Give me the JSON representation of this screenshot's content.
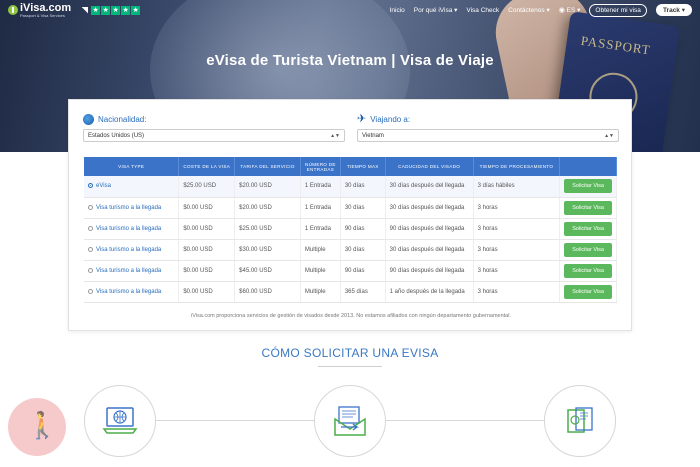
{
  "header": {
    "logo_name": "iVisa.com",
    "logo_sub": "Passport & Visa Services",
    "nav": [
      {
        "label": "Inicio"
      },
      {
        "label": "Por qué iVisa ▾"
      },
      {
        "label": "Visa Check"
      },
      {
        "label": "Contáctenos ▾"
      },
      {
        "label": "ES ▾"
      }
    ],
    "cta_outline": "Obtener mi visa",
    "cta_track": "Track ▾"
  },
  "hero": {
    "title": "eVisa de Turista Vietnam | Visa de Viaje",
    "passport_text": "PASSPORT"
  },
  "form": {
    "nationality_label": "Nacionalidad:",
    "nationality_value": "Estados Unidos (US)",
    "destination_label": "Viajando a:",
    "destination_value": "Vietnam"
  },
  "table": {
    "headers": [
      "Visa type",
      "Coste de la visa",
      "Tarifa del servicio",
      "Número de entradas",
      "Tiempo max",
      "Caducidad del visado",
      "Tiempo de procesamiento",
      ""
    ],
    "rows": [
      {
        "name": "eVisa",
        "cost": "$25.00 USD",
        "fee": "$20.00 USD",
        "entries": "1 Entrada",
        "max": "30 días",
        "validity": "30 días después del llegada",
        "processing": "3 días hábiles",
        "button": "Solicitar Visa",
        "selected": true
      },
      {
        "name": "Visa turismo a la llegada",
        "cost": "$0.00 USD",
        "fee": "$20.00 USD",
        "entries": "1 Entrada",
        "max": "30 días",
        "validity": "30 días después del llegada",
        "processing": "3 horas",
        "button": "Solicitar Visa",
        "selected": false
      },
      {
        "name": "Visa turismo a la llegada",
        "cost": "$0.00 USD",
        "fee": "$25.00 USD",
        "entries": "1 Entrada",
        "max": "90 días",
        "validity": "90 días después del llegada",
        "processing": "3 horas",
        "button": "Solicitar Visa",
        "selected": false
      },
      {
        "name": "Visa turismo a la llegada",
        "cost": "$0.00 USD",
        "fee": "$30.00 USD",
        "entries": "Multiple",
        "max": "30 días",
        "validity": "30 días después del llegada",
        "processing": "3 horas",
        "button": "Solicitar Visa",
        "selected": false
      },
      {
        "name": "Visa turismo a la llegada",
        "cost": "$0.00 USD",
        "fee": "$45.00 USD",
        "entries": "Multiple",
        "max": "90 días",
        "validity": "90 días después del llegada",
        "processing": "3 horas",
        "button": "Solicitar Visa",
        "selected": false
      },
      {
        "name": "Visa turismo a la llegada",
        "cost": "$0.00 USD",
        "fee": "$60.00 USD",
        "entries": "Multiple",
        "max": "365 días",
        "validity": "1 año después de la llegada",
        "processing": "3 horas",
        "button": "Solicitar Visa",
        "selected": false
      }
    ]
  },
  "disclaimer": "iVisa.com proporciona servicios de gestión de visados desde 2013. No estamos afiliados con ningún departamento gubernamental.",
  "how": {
    "title": "CÓMO SOLICITAR UNA EVISA"
  },
  "colors": {
    "accent": "#3b73c9",
    "green": "#5cb85c",
    "link": "#2a6ebb"
  }
}
